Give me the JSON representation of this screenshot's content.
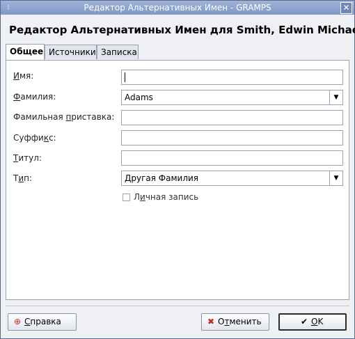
{
  "window": {
    "title": "Редактор Альтернативных Имен - GRAMPS",
    "close_icon": "close-icon",
    "app_icon": "gramps-icon"
  },
  "heading": "Редактор Альтернативных Имен для Smith, Edwin Michael",
  "tabs": [
    {
      "label": "Общее",
      "active": true
    },
    {
      "label": "Источники",
      "active": false
    },
    {
      "label": "Записка",
      "active": false
    }
  ],
  "form": {
    "given_name": {
      "label_underline": "И",
      "label_rest": "мя:",
      "value": ""
    },
    "surname": {
      "label_underline": "Ф",
      "label_rest": "амилия:",
      "value": "Adams"
    },
    "prefix": {
      "label_pre": "Фамильная ",
      "label_underline": "п",
      "label_rest": "риставка:",
      "value": ""
    },
    "suffix": {
      "label_pre": "Суффи",
      "label_underline": "к",
      "label_rest": "с:",
      "value": ""
    },
    "title": {
      "label_underline": "Т",
      "label_rest": "итул:",
      "value": ""
    },
    "type": {
      "label_pre": "Т",
      "label_underline": "и",
      "label_rest": "п:",
      "value": "Другая Фамилия"
    },
    "private": {
      "label_pre": "Л",
      "label_underline": "и",
      "label_rest": "чная запись",
      "checked": false
    }
  },
  "buttons": {
    "help": {
      "label_underline": "С",
      "label_rest": "правка",
      "icon": "lifebuoy-icon"
    },
    "cancel": {
      "label_pre": "О",
      "label_underline": "т",
      "label_rest": "менить",
      "icon": "x-icon"
    },
    "ok": {
      "label_underline": "O",
      "label_rest": "K",
      "icon": "checkmark-icon"
    }
  }
}
